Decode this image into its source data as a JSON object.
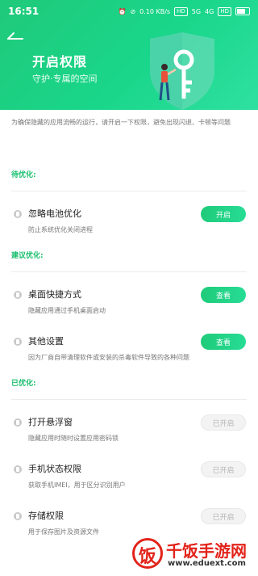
{
  "status_bar": {
    "time": "16:51",
    "speed": "0.10 KB/s",
    "hd1": "HD",
    "network": "5G",
    "signal": "4G",
    "hd2": "HD",
    "battery_level": 0.8
  },
  "header": {
    "title": "开启权限",
    "subtitle": "守护·专属的空间"
  },
  "notice": "为确保隐藏的应用流畅的运行，请开启一下权限，避免出现闪退、卡顿等问题",
  "sections": [
    {
      "title": "待优化:",
      "items": [
        {
          "name": "忽略电池优化",
          "desc": "防止系统优化关闭进程",
          "button": "开启",
          "active": true
        }
      ]
    },
    {
      "title": "建议优化:",
      "items": [
        {
          "name": "桌面快捷方式",
          "desc": "隐藏应用通过手机桌面启动",
          "button": "查看",
          "active": true
        },
        {
          "name": "其他设置",
          "desc": "因为厂商自带清理软件或安装的杀毒软件导致的各种问题",
          "button": "查看",
          "active": true
        }
      ]
    },
    {
      "title": "已优化:",
      "items": [
        {
          "name": "打开悬浮窗",
          "desc": "隐藏应用时随时设置应用密码锁",
          "button": "已开启",
          "active": false
        },
        {
          "name": "手机状态权限",
          "desc": "获取手机IMEI，用于区分识别用户",
          "button": "已开启",
          "active": false
        },
        {
          "name": "存储权限",
          "desc": "用于保存图片及资源文件",
          "button": "已开启",
          "active": false
        }
      ]
    }
  ],
  "watermark": {
    "logo_char": "饭",
    "name": "千饭手游网",
    "url": "www.eduext.com"
  }
}
